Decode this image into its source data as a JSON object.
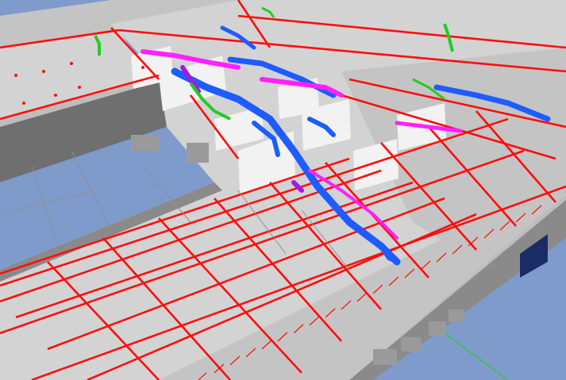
{
  "scene": {
    "kind": "3d-bim-mep-model",
    "view": "isometric",
    "colors": {
      "sky": "#7f9bcc",
      "floor_light": "#d3d3d3",
      "floor_mid": "#c4c4c4",
      "wall_dark": "#6f6f6f",
      "wall_mid": "#8a8a8a",
      "wall_top": "#bdbdbd",
      "interior_wall": "#f2f2f2",
      "sprinkler_pipe": "#ff0d0d",
      "duct_blue": "#1e5cff",
      "duct_magenta": "#ff22ff",
      "duct_purple": "#a01adf",
      "pipe_green": "#22cc22",
      "equipment_grey": "#9a9a9a",
      "dark_panel": "#1a2c66"
    },
    "systems": [
      {
        "name": "fire-sprinkler-piping",
        "color": "#ff0d0d"
      },
      {
        "name": "hvac-supply-duct",
        "color": "#1e5cff"
      },
      {
        "name": "hvac-return-duct",
        "color": "#ff22ff"
      },
      {
        "name": "plumbing-piping",
        "color": "#22cc22"
      }
    ]
  }
}
